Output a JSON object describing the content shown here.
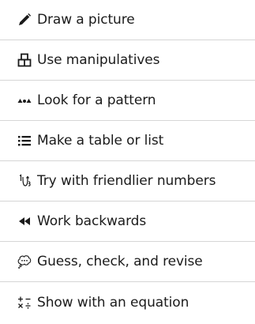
{
  "strategies": {
    "items": [
      {
        "label": "Draw a picture",
        "icon": "pencil-icon"
      },
      {
        "label": "Use manipulatives",
        "icon": "manipulatives-icon"
      },
      {
        "label": "Look for a pattern",
        "icon": "pattern-icon"
      },
      {
        "label": "Make a table or list",
        "icon": "list-icon"
      },
      {
        "label": "Try with friendlier numbers",
        "icon": "friendlier-numbers-icon"
      },
      {
        "label": "Work backwards",
        "icon": "rewind-icon"
      },
      {
        "label": "Guess, check, and revise",
        "icon": "thought-bubble-icon"
      },
      {
        "label": "Show with an equation",
        "icon": "equation-icon"
      }
    ]
  },
  "colors": {
    "text": "#1b1b1b",
    "icon": "#1b1b1b",
    "divider": "#d6d6d6",
    "background": "#ffffff"
  }
}
